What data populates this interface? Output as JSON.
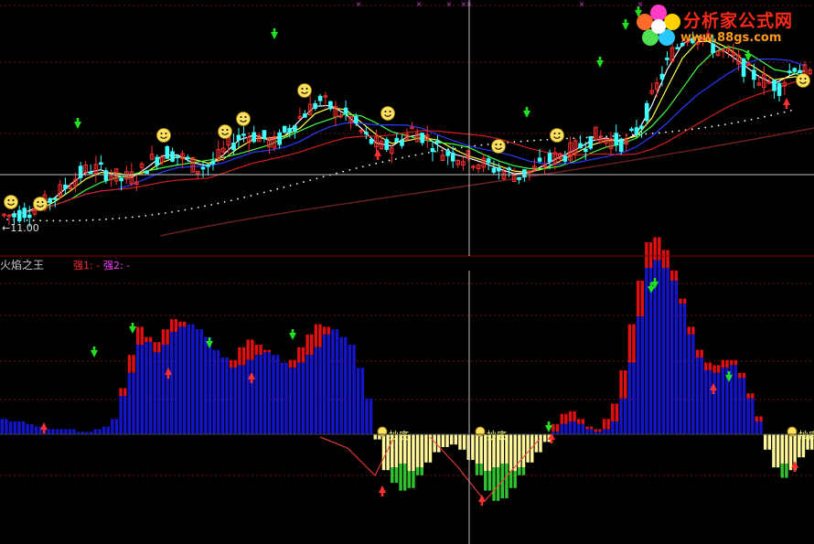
{
  "chart_data": [
    {
      "type": "candlestick",
      "panel": "price",
      "price_label": "←11.00",
      "series": [
        {
          "name": "MA-white",
          "color": "#ffffff"
        },
        {
          "name": "MA-yellow",
          "color": "#ffff40"
        },
        {
          "name": "MA-green",
          "color": "#40ff40"
        },
        {
          "name": "MA-blue",
          "color": "#2a3cff"
        },
        {
          "name": "MA-red",
          "color": "#d02020"
        },
        {
          "name": "MA-dotted",
          "color": "#ffffff"
        },
        {
          "name": "MA-darkred",
          "color": "#702020"
        }
      ],
      "close": [
        11.0,
        11.3,
        11.6,
        12.2,
        12.9,
        13.4,
        13.2,
        12.8,
        13.0,
        13.8,
        14.2,
        13.9,
        13.4,
        13.6,
        14.5,
        15.1,
        15.0,
        14.6,
        15.4,
        16.2,
        16.8,
        16.3,
        15.9,
        14.9,
        14.4,
        14.6,
        15.3,
        14.9,
        14.2,
        14.0,
        13.8,
        13.5,
        13.2,
        13.0,
        13.3,
        13.8,
        14.1,
        14.5,
        15.0,
        14.8,
        14.6,
        15.6,
        17.5,
        19.2,
        20.1,
        20.0,
        19.3,
        19.0,
        18.2,
        17.8,
        17.5,
        18.6,
        18.0
      ]
    },
    {
      "type": "bar",
      "panel": "indicator",
      "title": "火焰之王",
      "legend": [
        {
          "text": "强1: -",
          "color": "#ff3030"
        },
        {
          "text": "强2: -",
          "color": "#ff40ff"
        }
      ],
      "annotations": [
        "抄底",
        "抄底",
        "抄底"
      ],
      "colors": {
        "blue": "#1414c8",
        "red": "#e01010",
        "yellow": "#fff79a",
        "green": "#30c030"
      },
      "values": [
        0.6,
        0.5,
        0.5,
        0.4,
        0.3,
        0.2,
        0.2,
        0.2,
        0.2,
        0.1,
        0.1,
        0.2,
        0.3,
        0.6,
        1.5,
        2.4,
        3.5,
        3.6,
        3.2,
        3.5,
        4.0,
        4.2,
        4.3,
        4.1,
        3.8,
        3.3,
        3.0,
        2.6,
        2.7,
        2.9,
        3.1,
        3.2,
        3.1,
        2.8,
        2.6,
        2.8,
        3.1,
        3.4,
        3.9,
        4.1,
        3.8,
        3.5,
        2.6,
        1.4,
        -0.2,
        -1.4,
        -1.9,
        -2.2,
        -2.1,
        -1.6,
        -1.1,
        -0.7,
        -0.5,
        -0.4,
        -0.6,
        -1.0,
        -1.6,
        -2.2,
        -2.6,
        -2.5,
        -2.1,
        -1.6,
        -1.1,
        -0.7,
        -0.3,
        0.1,
        0.4,
        0.5,
        0.4,
        0.2,
        0.1,
        0.2,
        0.5,
        1.4,
        2.8,
        4.6,
        6.5,
        6.8,
        6.5,
        6.0,
        5.1,
        3.9,
        3.0,
        2.5,
        2.4,
        2.6,
        2.7,
        2.2,
        1.4,
        0.5,
        -0.6,
        -1.3,
        -1.7,
        -1.4,
        -0.9,
        -0.6
      ],
      "strength": [
        0,
        0,
        0,
        0,
        0,
        0,
        0,
        0,
        0,
        0,
        0,
        0,
        0,
        0.2,
        1.8,
        3.1,
        4.2,
        3.8,
        3.6,
        4.1,
        4.5,
        4.4,
        4.0,
        3.5,
        3.2,
        3.0,
        2.8,
        2.9,
        3.4,
        3.7,
        3.5,
        3.3,
        3.0,
        2.6,
        2.9,
        3.4,
        3.9,
        4.3,
        4.2,
        3.9,
        3.3,
        2.8,
        2.2,
        1.2,
        0,
        0,
        0,
        0,
        0,
        0,
        0,
        0,
        0,
        0,
        0,
        0,
        0,
        0,
        0,
        0,
        0,
        0,
        0,
        0,
        0,
        0.4,
        0.8,
        0.9,
        0.6,
        0.3,
        0.2,
        0.6,
        1.2,
        2.5,
        4.3,
        6.0,
        7.5,
        7.7,
        7.2,
        6.4,
        5.3,
        4.2,
        3.3,
        2.8,
        2.7,
        2.9,
        2.9,
        2.4,
        1.6,
        0.7,
        0,
        0,
        0,
        0,
        0,
        0
      ]
    }
  ],
  "logo": {
    "title": "分析家公式网",
    "subtitle": "www.88gs.com"
  }
}
